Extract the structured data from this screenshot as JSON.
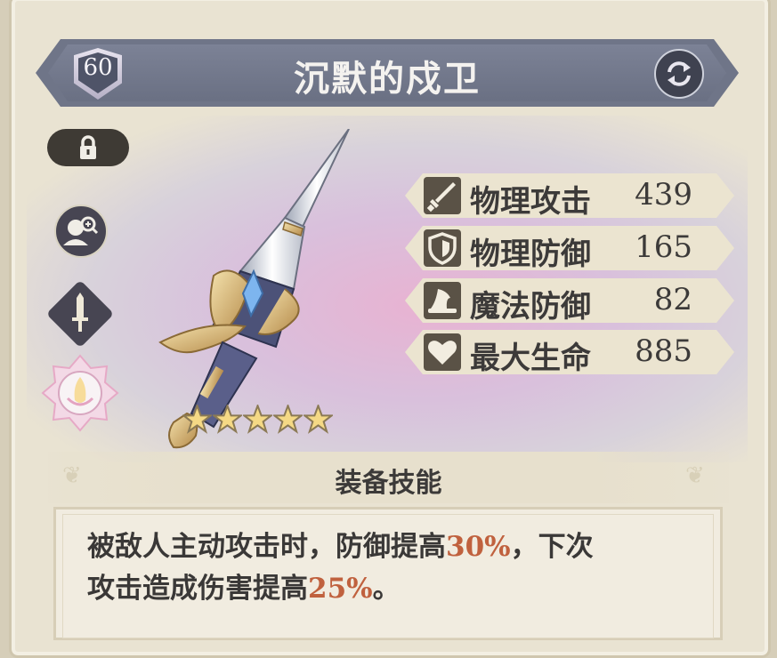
{
  "equipment": {
    "name": "沉默的戍卫",
    "level": "60",
    "star_count": 5
  },
  "stats": [
    {
      "label": "物理攻击",
      "value": "439",
      "icon": "sword-icon"
    },
    {
      "label": "物理防御",
      "value": "165",
      "icon": "shield-icon"
    },
    {
      "label": "魔法防御",
      "value": "82",
      "icon": "wizard-hat-icon"
    },
    {
      "label": "最大生命",
      "value": "885",
      "icon": "heart-icon"
    }
  ],
  "skill": {
    "header": "装备技能",
    "desc_part1": "被敌人主动攻击时，防御提高",
    "desc_value1": "30%",
    "desc_part2": "，下次",
    "desc_part3": "攻击造成伤害提高",
    "desc_value2": "25%",
    "desc_part4": "。"
  },
  "colors": {
    "highlight": "#c0613e",
    "title_bar": "#6f7588",
    "text_dark": "#3c3a39"
  }
}
